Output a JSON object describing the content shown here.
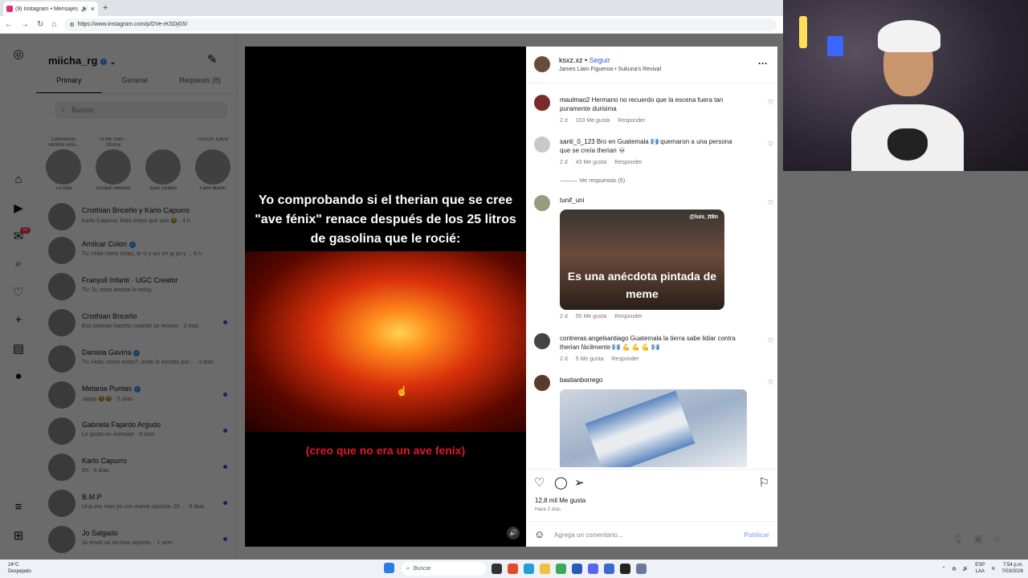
{
  "browser": {
    "tab_title": "(9) Instagram • Mensajes",
    "url": "https://www.instagram.com/p/DVe-rKSDjG5/"
  },
  "icons": {
    "back": "arrow-left-icon",
    "forward": "arrow-right-icon",
    "reload": "reload-icon",
    "home": "home-icon",
    "instagram": "instagram-logo-icon"
  },
  "dm": {
    "username": "miicha_rg",
    "tabs": [
      "Primary",
      "General",
      "Requests (8)"
    ],
    "search_placeholder": "Buscar",
    "notes": [
      {
        "bubble": "Cambiando nombre conv...",
        "name": "Tu nota"
      },
      {
        "bubble": "Si Me Sobr... Ozuna",
        "name": "Cristian Briceño"
      },
      {
        "bubble": "",
        "name": "Juan Giraldo"
      },
      {
        "bubble": "POLOS Kali B",
        "name": "Farid Martin"
      }
    ],
    "badge_count": "94",
    "chats": [
      {
        "name": "Cristhian Briceño y Karlo Capurro",
        "preview": "Karlo Capurro: Bala mejor que uno 😂 · 4 h",
        "unread": false
      },
      {
        "name": "Amilcar Colon",
        "preview": "Tú: Hola cómo estás, te vi y así en ig yo y ... 5 h",
        "unread": false
      },
      {
        "name": "Franyuli Infanti · UGC Creator",
        "preview": "Tú: Si, noso ahorita lo estoy",
        "unread": false
      },
      {
        "name": "Cristhian Briceño",
        "preview": "Eso podrian hacerlo cuando se reúnan · 2 días",
        "unread": true
      },
      {
        "name": "Daniela Gaviria",
        "preview": "Tú: Hola, cómo estás?, ando lo escribo por... · 3 días",
        "unread": false
      },
      {
        "name": "Melania Puntas",
        "preview": "Jajaja 😂😂 · 5 días",
        "unread": true
      },
      {
        "name": "Gabriela Fajardo Argudo",
        "preview": "Le gustó un mensaje · 6 días",
        "unread": true
      },
      {
        "name": "Karlo Capurro",
        "preview": "Eh · 6 días",
        "unread": true
      },
      {
        "name": "B.M.P",
        "preview": "Una vez mas yo con nueva canción, DI... · 6 días",
        "unread": true
      },
      {
        "name": "Jo Salgado",
        "preview": "Jo envió un archivo adjunto. · 1 sem",
        "unread": true
      }
    ]
  },
  "media": {
    "caption": "Yo comprobando si el therian que se cree \"ave fénix\" renace después de los 25 litros de gasolina que le rocié:",
    "subtitle": "(creo que no era un ave fenix)"
  },
  "post": {
    "author": "ksxz.xz",
    "follow": "Seguir",
    "audio": "James Liam Figueroa • Sukuna's Revival",
    "comments": [
      {
        "user": "maulmao2",
        "text": "Hermano no recuerdo que la escena fuera tan puramente durisima",
        "age": "2 d",
        "likes": "103 Me gusta",
        "reply": "Responder"
      },
      {
        "user": "santi_0_123",
        "text": "Bro en Guatemala 🇬🇹 quemaron a una persona que se creía therian 💀",
        "age": "2 d",
        "likes": "43 Me gusta",
        "reply": "Responder"
      },
      {
        "user": "tunif_uni",
        "text": "",
        "age": "2 d",
        "likes": "55 Me gusta",
        "reply": "Responder"
      },
      {
        "user": "contreras.angelsantiago",
        "text": "Guatemala la tierra sabe lidiar contra therian fácilmente 🇬🇹 💪 💪 💪 🇬🇹",
        "age": "2 d",
        "likes": "5 Me gusta",
        "reply": "Responder"
      },
      {
        "user": "bastianborrego",
        "text": "",
        "age": "",
        "likes": "",
        "reply": ""
      }
    ],
    "view_replies": "Ver respuestas (5)",
    "gif_tag": "@luis_tt8n",
    "gif_text": "Es una anécdota pintada de meme",
    "likes_total": "12,8 mil Me gusta",
    "posted_ago": "Hace 2 días",
    "comment_placeholder": "Agrega un comentario...",
    "publish": "Publicar"
  },
  "taskbar": {
    "weather_temp": "24°C",
    "weather_desc": "Despejado",
    "search": "Buscar",
    "lang1": "ESP",
    "lang2": "LAA",
    "time": "7:54 p.m.",
    "date": "7/03/2026"
  }
}
